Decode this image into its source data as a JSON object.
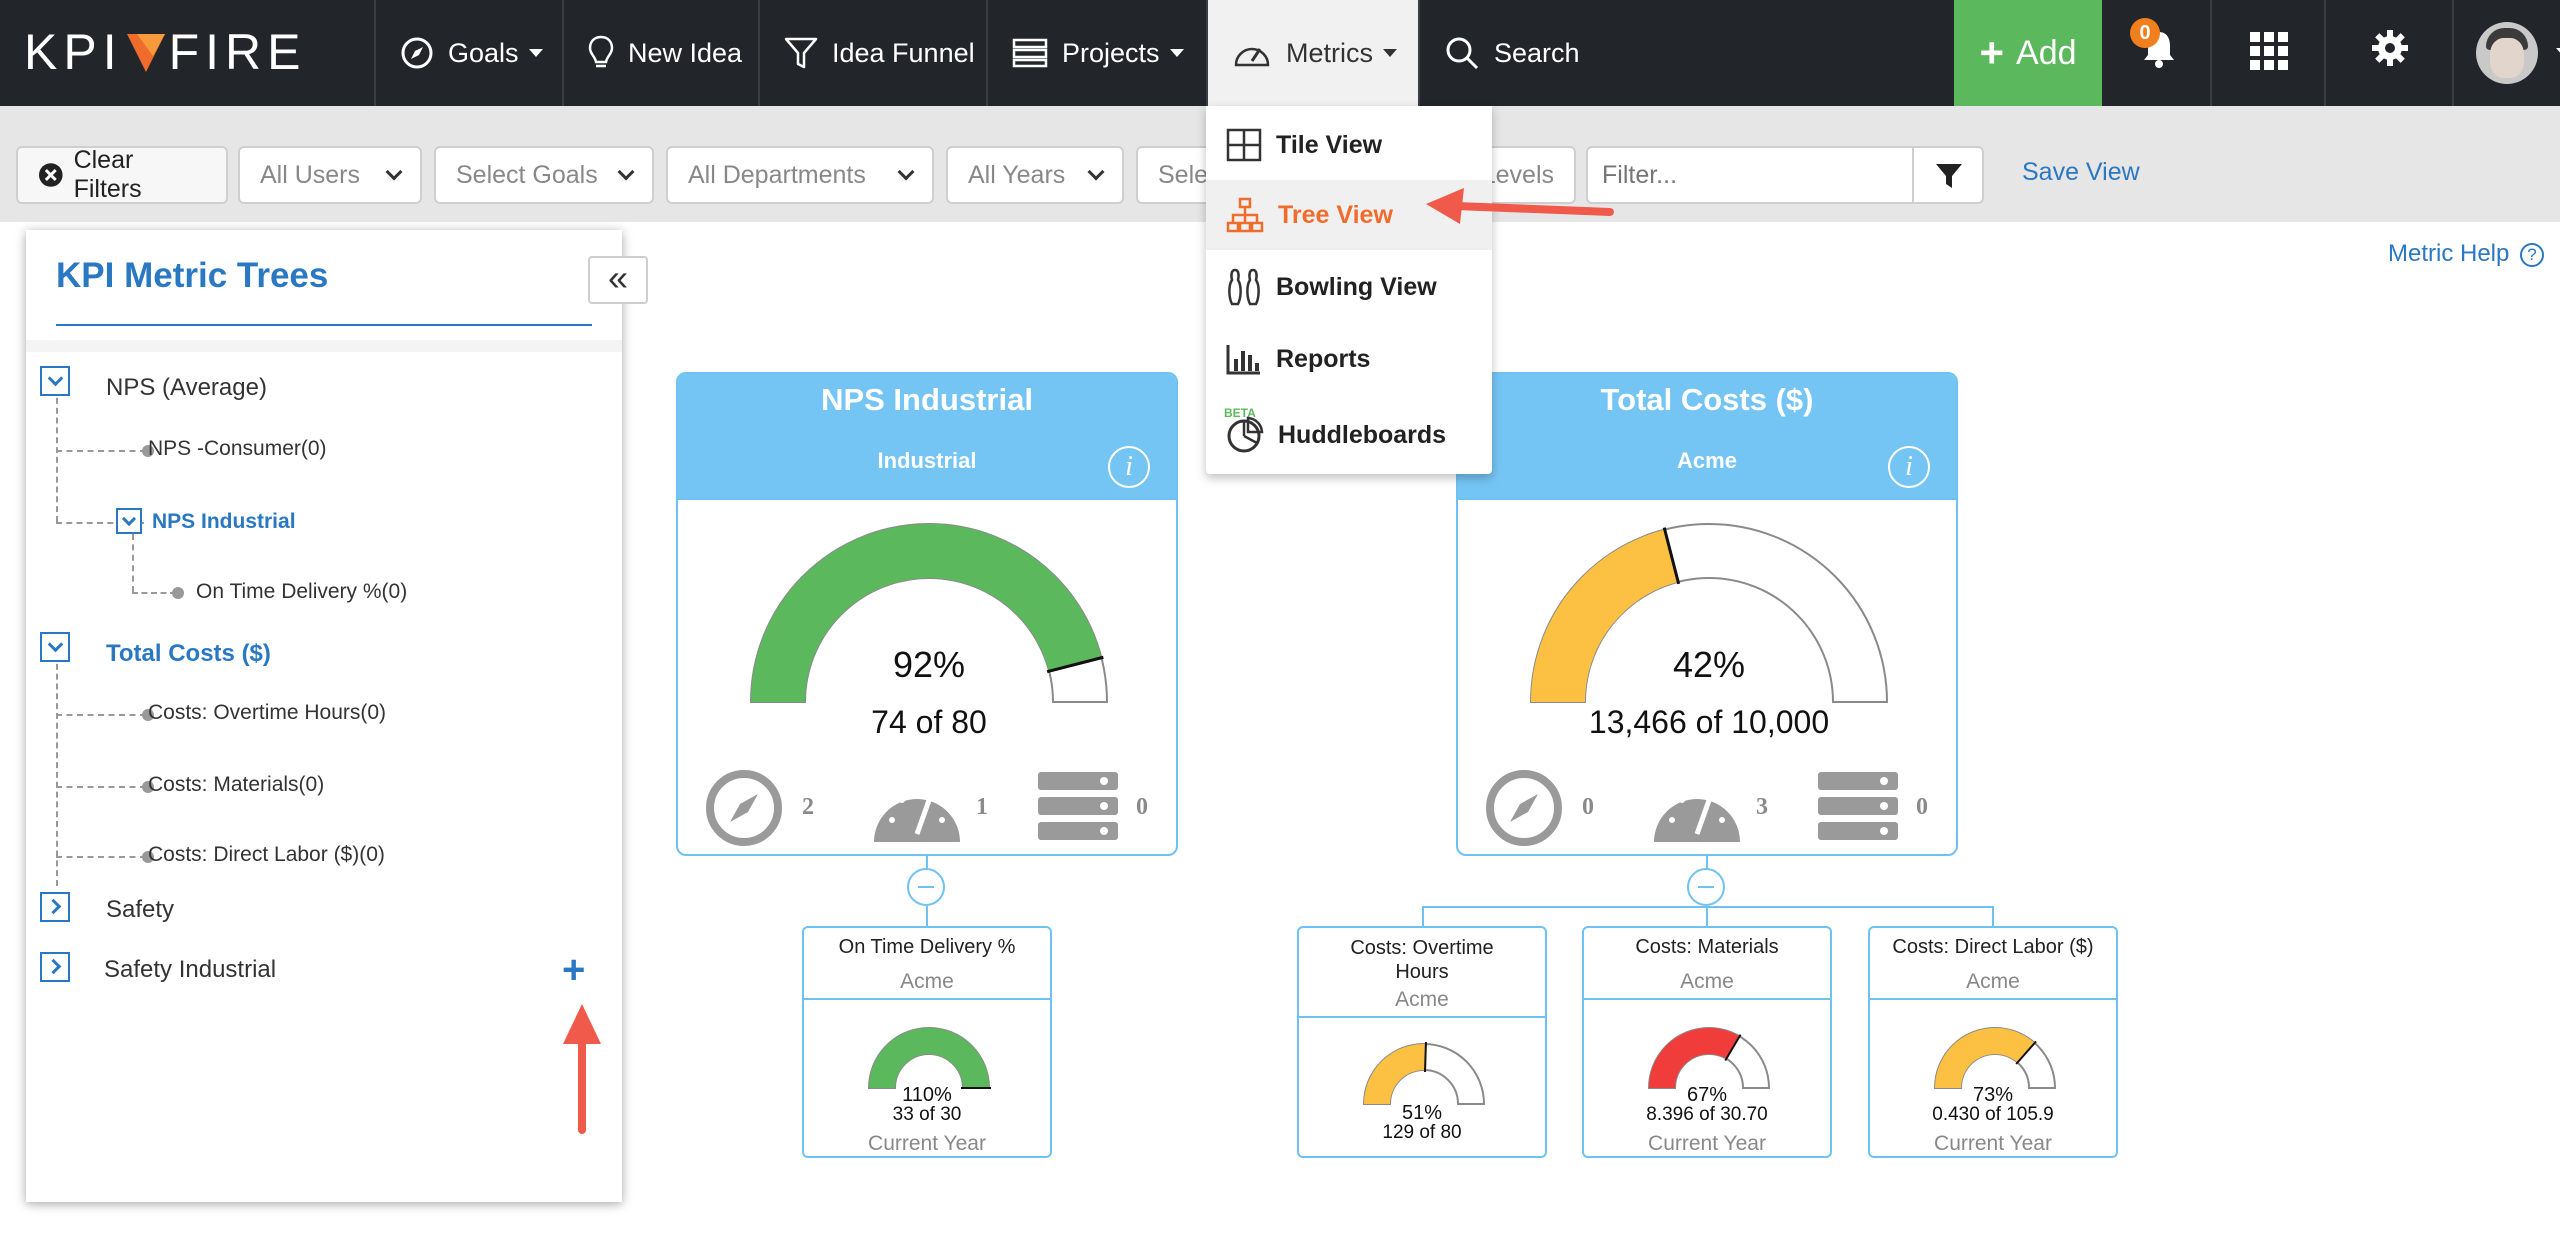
{
  "brand": {
    "logo_left": "KPI",
    "logo_right": "FIRE",
    "accent": "#ef6c2c"
  },
  "nav": {
    "goals": "Goals",
    "new_idea": "New Idea",
    "idea_funnel": "Idea Funnel",
    "projects": "Projects",
    "metrics": "Metrics",
    "search": "Search",
    "add": "Add",
    "notification_count": "0"
  },
  "filters": {
    "clear": "Clear Filters",
    "users": "All Users",
    "goals": "Select Goals",
    "departments": "All Departments",
    "years": "All Years",
    "select_partial": "Sele",
    "levels_partial": "Levels",
    "filter_placeholder": "Filter...",
    "save_view": "Save View"
  },
  "metrics_menu": {
    "tile_view": "Tile View",
    "tree_view": "Tree View",
    "bowling_view": "Bowling View",
    "reports": "Reports",
    "beta": "BETA",
    "huddleboards": "Huddleboards"
  },
  "metric_help": "Metric Help",
  "sidebar": {
    "title": "KPI Metric Trees",
    "items": [
      {
        "label": "NPS (Average)"
      },
      {
        "label": "NPS -Consumer(0)"
      },
      {
        "label": "NPS Industrial"
      },
      {
        "label": "On Time Delivery %(0)"
      },
      {
        "label": "Total Costs ($)"
      },
      {
        "label": "Costs: Overtime Hours(0)"
      },
      {
        "label": "Costs: Materials(0)"
      },
      {
        "label": "Costs: Direct Labor ($)(0)"
      },
      {
        "label": "Safety"
      },
      {
        "label": "Safety Industrial"
      }
    ]
  },
  "cards": [
    {
      "title": "NPS Industrial",
      "org": "Industrial",
      "percent": "92%",
      "value": "74 of 80",
      "fill": 0.92,
      "color": "#5cb85c",
      "goals": "2",
      "metrics": "1",
      "projects": "0"
    },
    {
      "title": "Total Costs ($)",
      "org": "Acme",
      "percent": "42%",
      "value": "13,466 of 10,000",
      "fill": 0.42,
      "color": "#fcc143",
      "goals": "0",
      "metrics": "3",
      "projects": "0"
    }
  ],
  "children": [
    {
      "title": "On Time Delivery %",
      "org": "Acme",
      "percent": "110%",
      "value": "33 of 30",
      "period": "Current Year",
      "fill": 1.0,
      "color": "#5cb85c"
    },
    {
      "title": "Costs: Overtime Hours",
      "org": "Acme",
      "percent": "51%",
      "value": "129 of 80",
      "period": "",
      "fill": 0.51,
      "color": "#fcc143"
    },
    {
      "title": "Costs: Materials",
      "org": "Acme",
      "percent": "67%",
      "value": "8.396 of 30.70",
      "period": "Current Year",
      "fill": 0.67,
      "color": "#f13c3c"
    },
    {
      "title": "Costs: Direct Labor ($)",
      "org": "Acme",
      "percent": "73%",
      "value": "0.430 of 105.9",
      "period": "Current Year",
      "fill": 0.73,
      "color": "#fcc143"
    }
  ]
}
